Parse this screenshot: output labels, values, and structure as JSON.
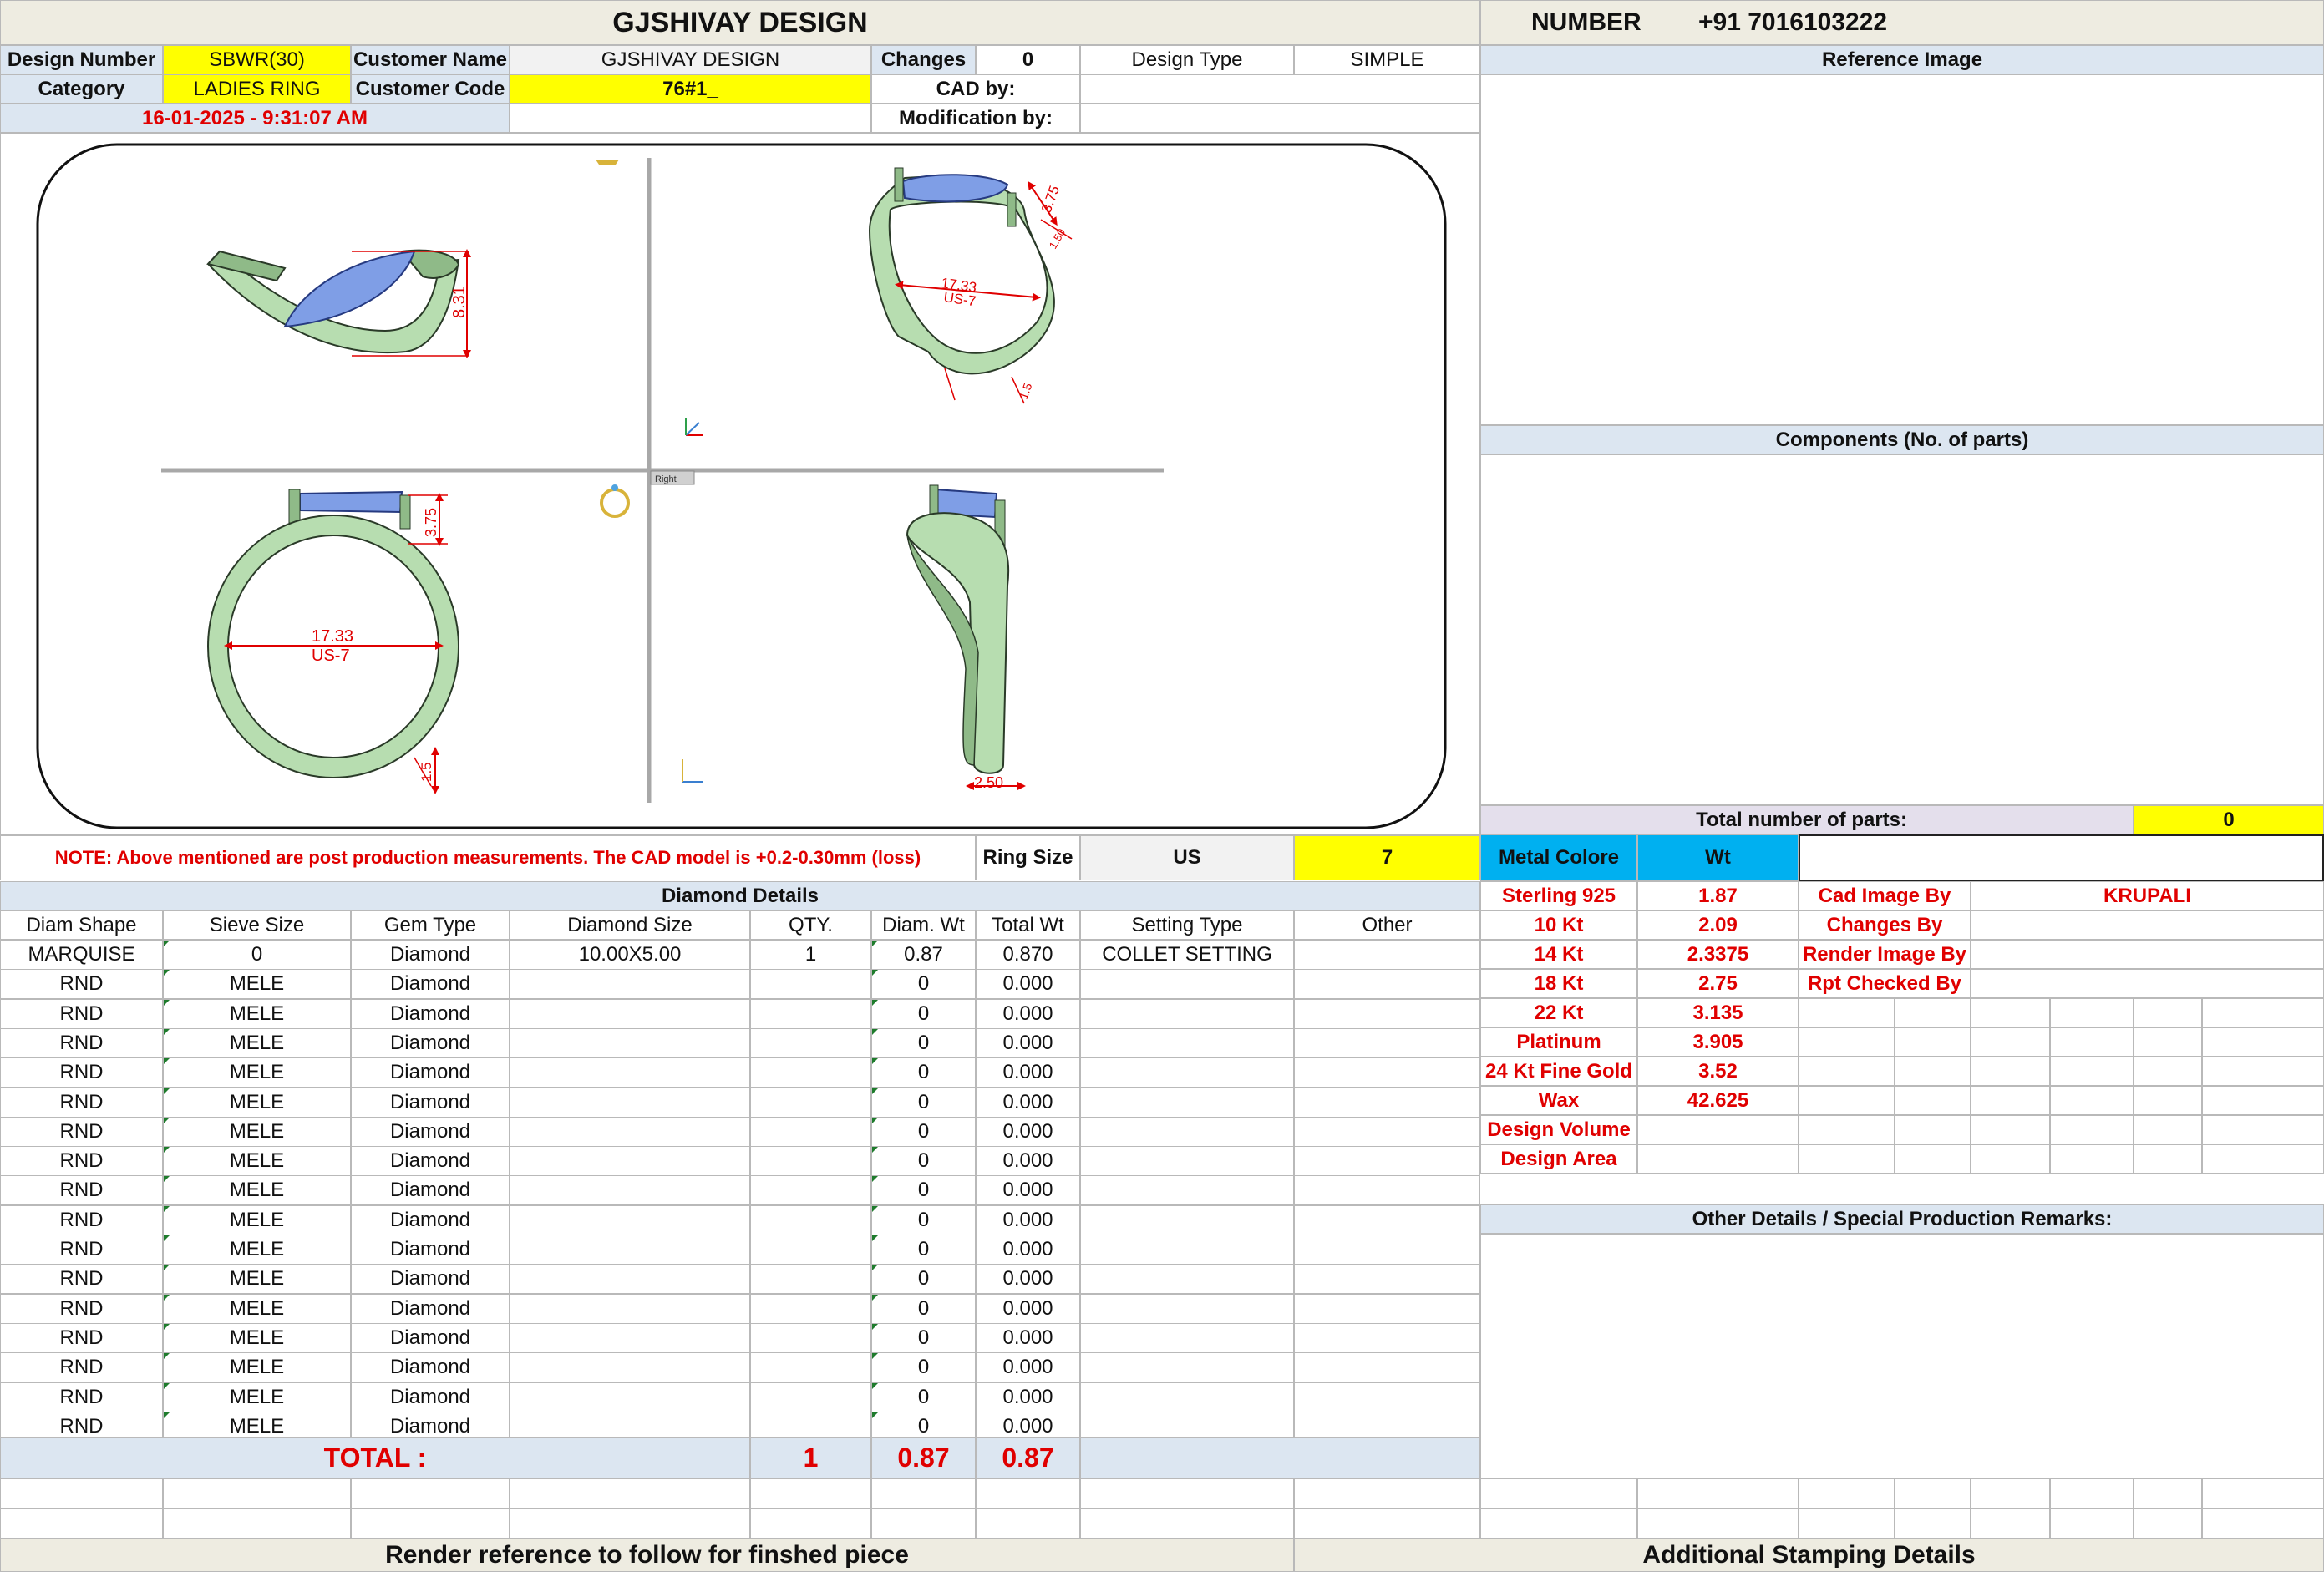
{
  "header": {
    "title": "GJSHIVAY DESIGN",
    "number_label": "NUMBER",
    "number_value": "+91 7016103222"
  },
  "info": {
    "design_number_label": "Design Number",
    "design_number": "SBWR(30)",
    "customer_name_label": "Customer Name",
    "customer_name": "GJSHIVAY DESIGN",
    "changes_label": "Changes",
    "changes": "0",
    "design_type_label": "Design Type",
    "design_type": "SIMPLE",
    "category_label": "Category",
    "category": "LADIES RING",
    "customer_code_label": "Customer Code",
    "customer_code": "76#1_",
    "cad_by_label": "CAD by:",
    "cad_by": "",
    "timestamp": "16-01-2025 - 9:31:07 AM",
    "modification_label": "Modification by:",
    "modification": ""
  },
  "right_panel": {
    "reference_image": "Reference Image",
    "components": "Components (No. of parts)",
    "total_parts_label": "Total number of parts:",
    "total_parts": "0",
    "other_details": "Other Details / Special Production Remarks:"
  },
  "cad": {
    "dim_top_left": "8.31",
    "dim_top_right_a": "3.75",
    "dim_top_right_b": "1.50",
    "dim_top_right_c": "1.5",
    "ring_diameter": "17.33",
    "ring_size": "US-7",
    "dim_bottom_left_a": "3.75",
    "dim_bottom_left_b": "1.5",
    "dim_bottom_right": "2.50",
    "view_label": "Right"
  },
  "note": "NOTE: Above mentioned are post production measurements. The CAD model is +0.2-0.30mm (loss)",
  "ring_size": {
    "label": "Ring Size",
    "unit": "US",
    "value": "7"
  },
  "metal": {
    "header_label": "Metal Colore",
    "header_wt": "Wt",
    "rows": [
      {
        "name": "Sterling 925",
        "wt": "1.87",
        "role": "Cad Image By",
        "person": "KRUPALI"
      },
      {
        "name": "10 Kt",
        "wt": "2.09",
        "role": "Changes By",
        "person": ""
      },
      {
        "name": "14 Kt",
        "wt": "2.3375",
        "role": "Render Image By",
        "person": ""
      },
      {
        "name": "18 Kt",
        "wt": "2.75",
        "role": "Rpt Checked By",
        "person": ""
      },
      {
        "name": "22 Kt",
        "wt": "3.135"
      },
      {
        "name": "Platinum",
        "wt": "3.905"
      },
      {
        "name": "24 Kt Fine Gold",
        "wt": "3.52"
      },
      {
        "name": "Wax",
        "wt": "42.625"
      },
      {
        "name": "Design Volume",
        "wt": ""
      },
      {
        "name": "Design Area",
        "wt": ""
      }
    ]
  },
  "diamonds": {
    "title": "Diamond Details",
    "headers": [
      "Diam Shape",
      "Sieve Size",
      "Gem Type",
      "Diamond Size",
      "QTY.",
      "Diam. Wt",
      "Total Wt",
      "Setting Type",
      "Other"
    ],
    "rows": [
      [
        "MARQUISE",
        "0",
        "Diamond",
        "10.00X5.00",
        "1",
        "0.87",
        "0.870",
        "COLLET SETTING",
        ""
      ],
      [
        "RND",
        "MELE",
        "Diamond",
        "",
        "",
        "0",
        "0.000",
        "",
        ""
      ],
      [
        "RND",
        "MELE",
        "Diamond",
        "",
        "",
        "0",
        "0.000",
        "",
        ""
      ],
      [
        "RND",
        "MELE",
        "Diamond",
        "",
        "",
        "0",
        "0.000",
        "",
        ""
      ],
      [
        "RND",
        "MELE",
        "Diamond",
        "",
        "",
        "0",
        "0.000",
        "",
        ""
      ],
      [
        "RND",
        "MELE",
        "Diamond",
        "",
        "",
        "0",
        "0.000",
        "",
        ""
      ],
      [
        "RND",
        "MELE",
        "Diamond",
        "",
        "",
        "0",
        "0.000",
        "",
        ""
      ],
      [
        "RND",
        "MELE",
        "Diamond",
        "",
        "",
        "0",
        "0.000",
        "",
        ""
      ],
      [
        "RND",
        "MELE",
        "Diamond",
        "",
        "",
        "0",
        "0.000",
        "",
        ""
      ],
      [
        "RND",
        "MELE",
        "Diamond",
        "",
        "",
        "0",
        "0.000",
        "",
        ""
      ],
      [
        "RND",
        "MELE",
        "Diamond",
        "",
        "",
        "0",
        "0.000",
        "",
        ""
      ],
      [
        "RND",
        "MELE",
        "Diamond",
        "",
        "",
        "0",
        "0.000",
        "",
        ""
      ],
      [
        "RND",
        "MELE",
        "Diamond",
        "",
        "",
        "0",
        "0.000",
        "",
        ""
      ],
      [
        "RND",
        "MELE",
        "Diamond",
        "",
        "",
        "0",
        "0.000",
        "",
        ""
      ],
      [
        "RND",
        "MELE",
        "Diamond",
        "",
        "",
        "0",
        "0.000",
        "",
        ""
      ],
      [
        "RND",
        "MELE",
        "Diamond",
        "",
        "",
        "0",
        "0.000",
        "",
        ""
      ],
      [
        "RND",
        "MELE",
        "Diamond",
        "",
        "",
        "0",
        "0.000",
        "",
        ""
      ]
    ],
    "total_label": "TOTAL :",
    "total_qty": "1",
    "total_diam_wt": "0.87",
    "total_wt": "0.87"
  },
  "footer": {
    "left": "Render reference to follow for finshed piece",
    "right": "Additional Stamping Details"
  },
  "colors": {
    "ring_metal": "#c4e6bb",
    "gem": "#7f9ee6",
    "dimension": "#e00000",
    "highlight": "#ffff00",
    "header_blue": "#dce6f1",
    "metal_header": "#00b0f0"
  }
}
